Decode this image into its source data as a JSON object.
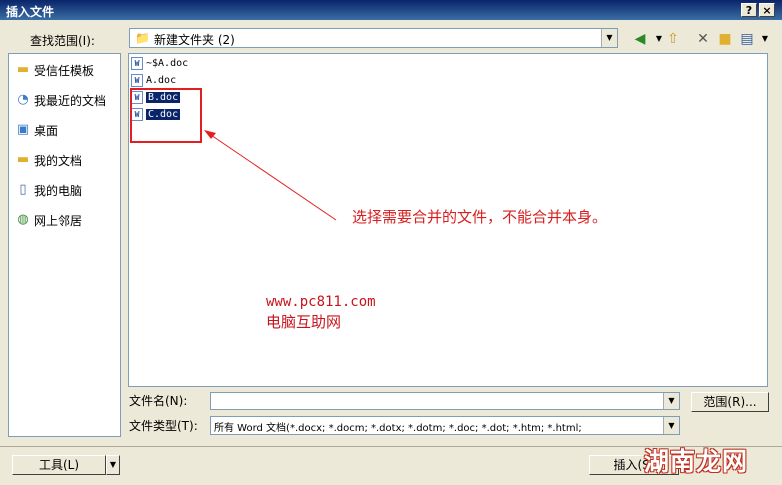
{
  "window": {
    "title": "插入文件",
    "help_label": "?",
    "close_label": "×"
  },
  "look_in": {
    "label": "查找范围(I):",
    "value": "新建文件夹 (2)"
  },
  "places": [
    {
      "label": "受信任模板",
      "icon": "folder-icon"
    },
    {
      "label": "我最近的文档",
      "icon": "recent-documents-icon"
    },
    {
      "label": "桌面",
      "icon": "desktop-icon"
    },
    {
      "label": "我的文档",
      "icon": "my-documents-icon"
    },
    {
      "label": "我的电脑",
      "icon": "my-computer-icon"
    },
    {
      "label": "网上邻居",
      "icon": "network-icon"
    }
  ],
  "files": [
    {
      "name": "~$A.doc",
      "selected": false
    },
    {
      "name": "A.doc",
      "selected": false
    },
    {
      "name": "B.doc",
      "selected": true
    },
    {
      "name": "C.doc",
      "selected": true
    }
  ],
  "annotation": "选择需要合并的文件，不能合并本身。",
  "watermark": {
    "url": "www.pc811.com",
    "name": "电脑互助网"
  },
  "filename": {
    "label": "文件名(N):",
    "value": ""
  },
  "filetype": {
    "label": "文件类型(T):",
    "value": "所有 Word 文档(*.docx; *.docm; *.dotx; *.dotm; *.doc; *.dot; *.htm; *.html;"
  },
  "buttons": {
    "range": "范围(R)...",
    "tools": "工具(L)",
    "insert": "插入(S)"
  },
  "logo": "湖南龙网",
  "colors": {
    "title_bar": "#0a246a",
    "selection": "#0a246a",
    "annotation": "#d81e1e"
  }
}
